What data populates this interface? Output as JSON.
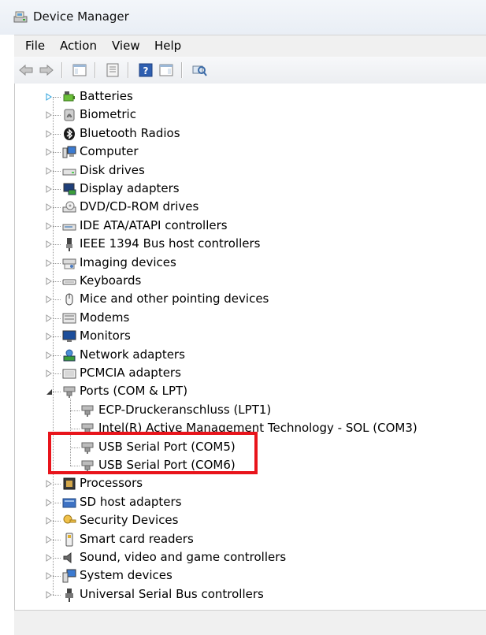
{
  "window": {
    "title": "Device Manager",
    "icon": "device-manager-icon"
  },
  "menu": [
    "File",
    "Action",
    "View",
    "Help"
  ],
  "toolbar": {
    "buttons": [
      "back-arrow-icon",
      "forward-arrow-icon",
      "show-hide-console-tree-icon",
      "properties-icon",
      "help-icon",
      "action-pane-icon",
      "scan-hardware-icon"
    ]
  },
  "tree": {
    "categories": [
      {
        "label": "Batteries",
        "icon": "battery-icon",
        "expanded": false
      },
      {
        "label": "Biometric",
        "icon": "biometric-icon",
        "expanded": false
      },
      {
        "label": "Bluetooth Radios",
        "icon": "bluetooth-icon",
        "expanded": false
      },
      {
        "label": "Computer",
        "icon": "computer-icon",
        "expanded": false
      },
      {
        "label": "Disk drives",
        "icon": "disk-drive-icon",
        "expanded": false
      },
      {
        "label": "Display adapters",
        "icon": "display-adapter-icon",
        "expanded": false
      },
      {
        "label": "DVD/CD-ROM drives",
        "icon": "dvd-drive-icon",
        "expanded": false
      },
      {
        "label": "IDE ATA/ATAPI controllers",
        "icon": "ide-controller-icon",
        "expanded": false
      },
      {
        "label": "IEEE 1394 Bus host controllers",
        "icon": "ieee1394-icon",
        "expanded": false
      },
      {
        "label": "Imaging devices",
        "icon": "imaging-device-icon",
        "expanded": false
      },
      {
        "label": "Keyboards",
        "icon": "keyboard-icon",
        "expanded": false
      },
      {
        "label": "Mice and other pointing devices",
        "icon": "mouse-icon",
        "expanded": false
      },
      {
        "label": "Modems",
        "icon": "modem-icon",
        "expanded": false
      },
      {
        "label": "Monitors",
        "icon": "monitor-icon",
        "expanded": false
      },
      {
        "label": "Network adapters",
        "icon": "network-adapter-icon",
        "expanded": false
      },
      {
        "label": "PCMCIA adapters",
        "icon": "pcmcia-icon",
        "expanded": false
      },
      {
        "label": "Ports (COM & LPT)",
        "icon": "port-icon",
        "expanded": true,
        "children": [
          "ECP-Druckeranschluss (LPT1)",
          "Intel(R) Active Management Technology - SOL (COM3)",
          "USB Serial Port (COM5)",
          "USB Serial Port (COM6)"
        ]
      },
      {
        "label": "Processors",
        "icon": "processor-icon",
        "expanded": false
      },
      {
        "label": "SD host adapters",
        "icon": "sd-adapter-icon",
        "expanded": false
      },
      {
        "label": "Security Devices",
        "icon": "security-device-icon",
        "expanded": false
      },
      {
        "label": "Smart card readers",
        "icon": "smart-card-reader-icon",
        "expanded": false
      },
      {
        "label": "Sound, video and game controllers",
        "icon": "sound-icon",
        "expanded": false
      },
      {
        "label": "System devices",
        "icon": "system-device-icon",
        "expanded": false
      },
      {
        "label": "Universal Serial Bus controllers",
        "icon": "usb-icon",
        "expanded": false
      }
    ]
  },
  "colors": {
    "highlight": "#e8141b",
    "expander_collapsed": "#2aa0dc"
  }
}
